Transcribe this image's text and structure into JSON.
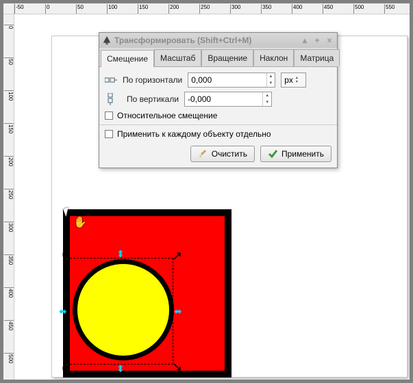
{
  "dialog": {
    "title": "Трансформировать (Shift+Ctrl+M)",
    "tabs": [
      "Смещение",
      "Масштаб",
      "Вращение",
      "Наклон",
      "Матрица"
    ],
    "active_tab": 0,
    "move": {
      "horizontal_label": "По горизонтали",
      "horizontal_value": "0,000",
      "vertical_label": "По вертикали",
      "vertical_value": "-0,000",
      "unit": "px",
      "relative_label": "Относительное смещение",
      "relative_checked": false
    },
    "apply_each_label": "Применить к каждому объекту отдельно",
    "apply_each_checked": false,
    "clear_label": "Очистить",
    "apply_label": "Применить"
  },
  "ruler": {
    "h_ticks": [
      "-50",
      "0",
      "50",
      "100",
      "150",
      "200",
      "250",
      "300",
      "350",
      "400",
      "450",
      "500",
      "550"
    ],
    "v_ticks": [
      "0",
      "50",
      "100",
      "150",
      "200",
      "250",
      "300",
      "350",
      "400",
      "450",
      "500"
    ]
  },
  "icons": {
    "minimize": "▴",
    "maximize": "+",
    "close": "×",
    "horiz": "⇔",
    "vert": "⇕",
    "hand": "✋"
  }
}
